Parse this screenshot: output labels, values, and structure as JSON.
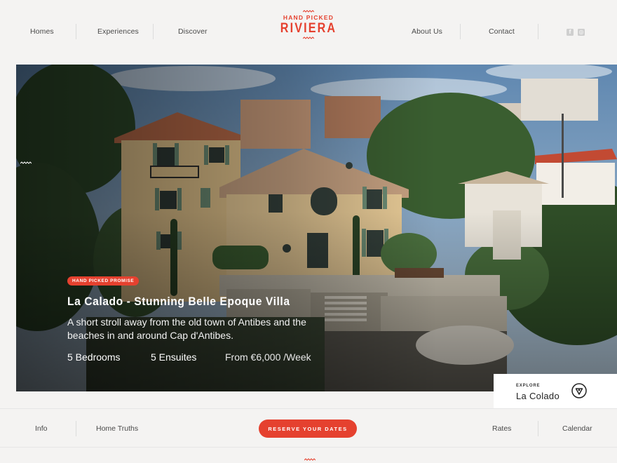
{
  "header": {
    "nav_left": [
      "Homes",
      "Experiences",
      "Discover"
    ],
    "nav_right": [
      "About Us",
      "Contact"
    ],
    "logo_small": "HAND PICKED",
    "logo_big": "RIVIERA",
    "social": [
      {
        "icon": "facebook-icon",
        "glyph": "f"
      },
      {
        "icon": "instagram-icon",
        "glyph": "◎"
      }
    ]
  },
  "hero": {
    "badge": "HAND PICKED PROMISE",
    "title": "La Calado - Stunning Belle Epoque Villa",
    "description": "A short stroll away from the old town of Antibes and the beaches in and around Cap d'Antibes.",
    "bedrooms": "5 Bedrooms",
    "ensuites": "5 Ensuites",
    "price": "From €6,000 /Week"
  },
  "explore": {
    "kicker": "EXPLORE",
    "name": "La Colado",
    "icon": "location-pin-icon"
  },
  "subnav": {
    "left": [
      "Info",
      "Home Truths"
    ],
    "cta": "RESERVE YOUR DATES",
    "right": [
      "Rates",
      "Calendar"
    ]
  },
  "colors": {
    "accent": "#e5412f",
    "background": "#f4f3f2",
    "text": "#4a4a4a"
  }
}
